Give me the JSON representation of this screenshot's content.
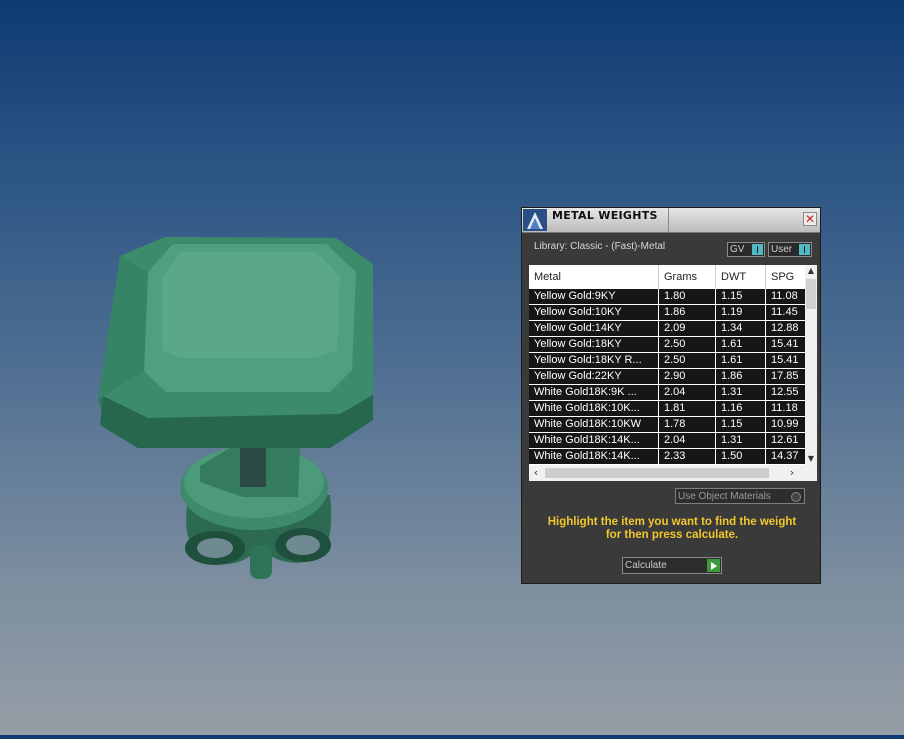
{
  "viewport": {
    "model_icon": "emerald-cut-ring-model"
  },
  "panel": {
    "title": "METAL WEIGHTS",
    "close_icon": "close-icon",
    "library_label": "Library: Classic - (Fast)-Metal",
    "toggle_gv": "GV",
    "toggle_user": "User",
    "table": {
      "headers": [
        "Metal",
        "Grams",
        "DWT",
        "SPG"
      ],
      "rows": [
        [
          "Yellow Gold:9KY",
          "1.80",
          "1.15",
          "11.08"
        ],
        [
          "Yellow Gold:10KY",
          "1.86",
          "1.19",
          "11.45"
        ],
        [
          "Yellow Gold:14KY",
          "2.09",
          "1.34",
          "12.88"
        ],
        [
          "Yellow Gold:18KY",
          "2.50",
          "1.61",
          "15.41"
        ],
        [
          "Yellow Gold:18KY R...",
          "2.50",
          "1.61",
          "15.41"
        ],
        [
          "Yellow Gold:22KY",
          "2.90",
          "1.86",
          "17.85"
        ],
        [
          "White Gold18K:9K ...",
          "2.04",
          "1.31",
          "12.55"
        ],
        [
          "White Gold18K:10K...",
          "1.81",
          "1.16",
          "11.18"
        ],
        [
          "White Gold18K:10KW",
          "1.78",
          "1.15",
          "10.99"
        ],
        [
          "White Gold18K:14K...",
          "2.04",
          "1.31",
          "12.61"
        ],
        [
          "White Gold18K:14K...",
          "2.33",
          "1.50",
          "14.37"
        ]
      ]
    },
    "use_object_materials": "Use Object Materials",
    "hint_line1": "Highlight the item you want to find the weight",
    "hint_line2": "for then press calculate.",
    "calculate_label": "Calculate",
    "colors": {
      "hint": "#f1c72d",
      "accent": "#52b8c4",
      "play": "#3b9b3b",
      "model": "#3a8c6c"
    }
  }
}
